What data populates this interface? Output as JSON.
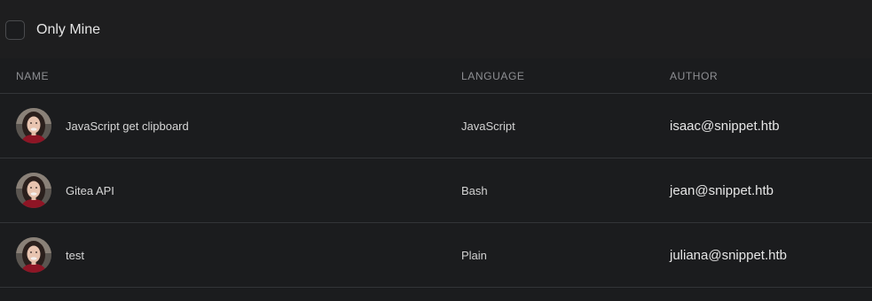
{
  "filter": {
    "only_mine_label": "Only Mine",
    "only_mine_checked": false
  },
  "table": {
    "headers": {
      "name": "NAME",
      "language": "LANGUAGE",
      "author": "AUTHOR"
    },
    "rows": [
      {
        "name": "JavaScript get clipboard",
        "language": "JavaScript",
        "author": "isaac@snippet.htb",
        "avatar_icon": "user-avatar-icon"
      },
      {
        "name": "Gitea API",
        "language": "Bash",
        "author": "jean@snippet.htb",
        "avatar_icon": "user-avatar-icon"
      },
      {
        "name": "test",
        "language": "Plain",
        "author": "juliana@snippet.htb",
        "avatar_icon": "user-avatar-icon"
      }
    ]
  },
  "colors": {
    "background": "#1b1c1e",
    "filter_bar": "#1e1e1f",
    "divider": "#333538",
    "header_text": "#8e8f93"
  }
}
